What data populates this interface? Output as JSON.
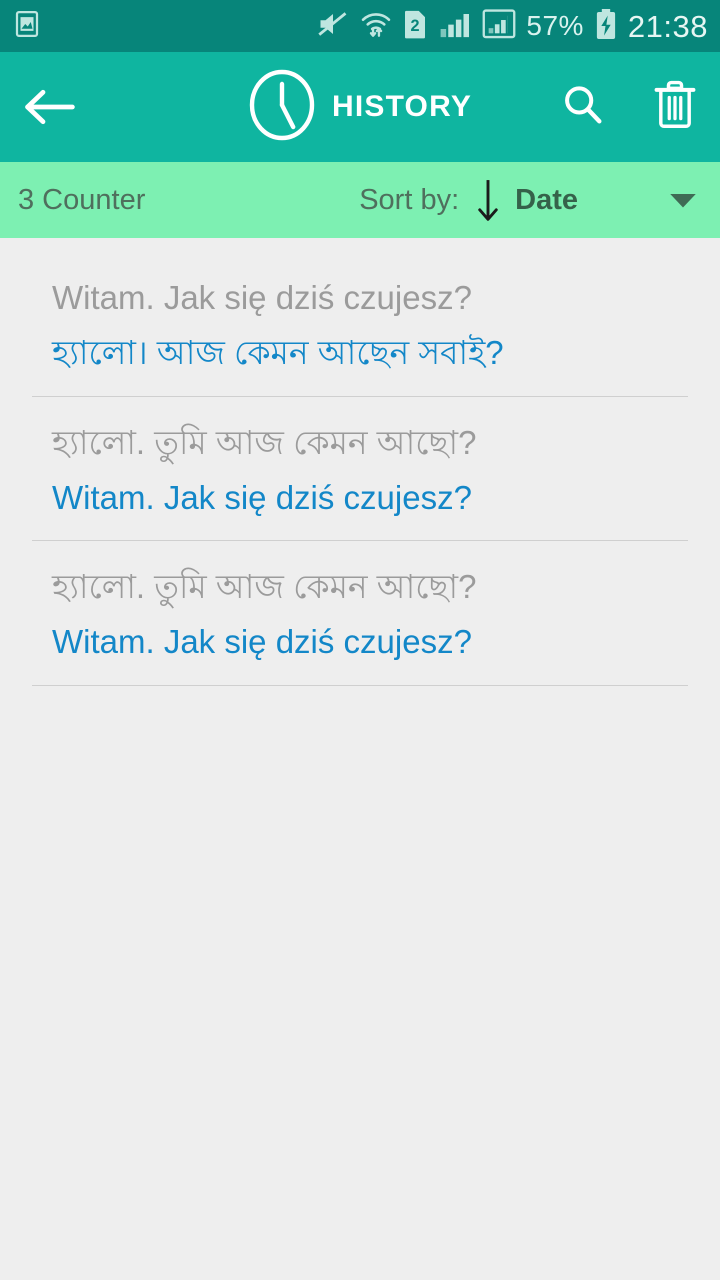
{
  "statusbar": {
    "icons_left": [
      "gallery-image-icon"
    ],
    "icons_right": [
      "mute-icon",
      "wifi-transfer-icon",
      "sim2-icon",
      "signal-bars-icon",
      "signal-bars-boxed-icon"
    ],
    "battery_percent": "57%",
    "battery_state": "charging",
    "time": "21:38"
  },
  "appbar": {
    "back_label": "back-arrow",
    "title": "HISTORY",
    "clock_icon": "clock-icon",
    "search_icon": "search-icon",
    "delete_icon": "trash-icon"
  },
  "sortbar": {
    "counter": "3 Counter",
    "sort_label": "Sort by:",
    "sort_direction": "descending",
    "sort_value": "Date",
    "caret": "chevron-down-icon"
  },
  "history": {
    "items": [
      {
        "source": "Witam. Jak się dziś czujesz?",
        "target": "হ্যালো। আজ কেমন আছেন সবাই?"
      },
      {
        "source": "হ্যালো. তুমি আজ কেমন আছো?",
        "target": "Witam. Jak się dziś czujesz?"
      },
      {
        "source": "হ্যালো. তুমি আজ কেমন আছো?",
        "target": "Witam. Jak się dziś czujesz?"
      }
    ]
  },
  "colors": {
    "statusbar_bg": "#07857a",
    "appbar_bg": "#0fb5a0",
    "sortbar_bg": "#7df0b2",
    "page_bg": "#eeeeee",
    "source_text": "#9b9b9b",
    "target_text": "#1387c8",
    "sort_value_text": "#35624a"
  }
}
